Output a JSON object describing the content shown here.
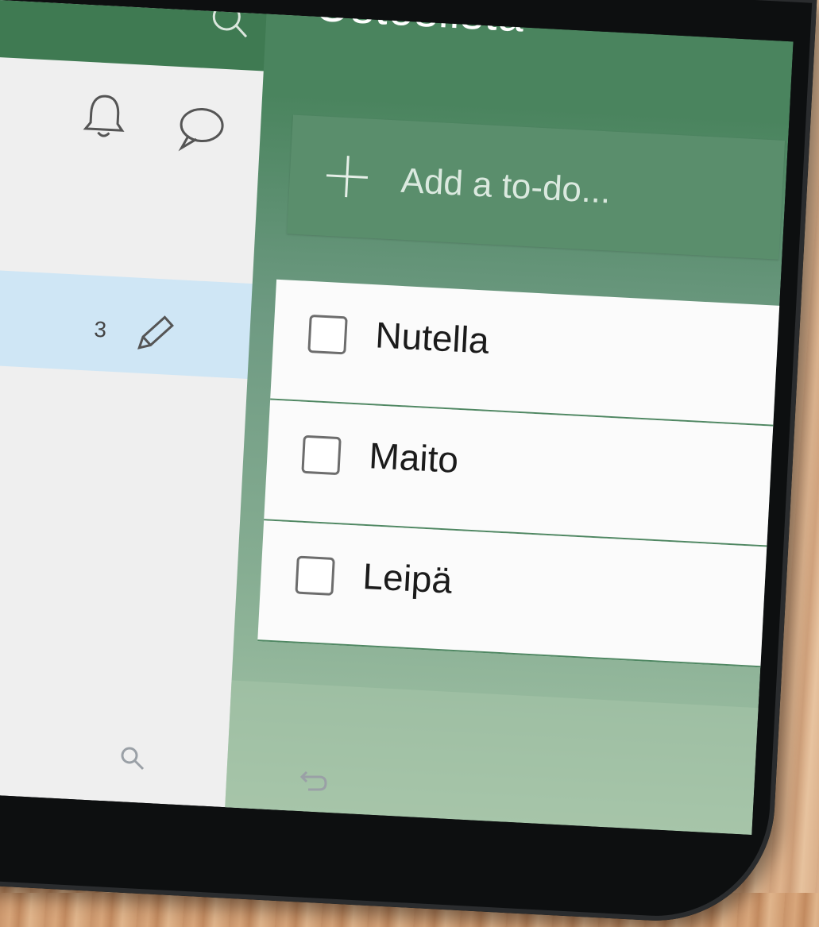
{
  "app": {
    "list_title": "Ostoslista",
    "add_placeholder": "Add a to-do...",
    "selected_list_count": "3"
  },
  "todos": [
    {
      "label": "Nutella",
      "checked": false
    },
    {
      "label": "Maito",
      "checked": false
    },
    {
      "label": "Leipä",
      "checked": false
    }
  ],
  "colors": {
    "accent_green": "#4a845e",
    "selected_row_blue": "#cfe6f5",
    "left_pane_bg": "#efefef"
  },
  "icons": {
    "top_search": "search-icon",
    "notifications": "bell-icon",
    "comments": "chat-icon",
    "edit": "pencil-icon",
    "add": "plus-icon",
    "nav_search": "search-icon",
    "nav_back": "back-icon"
  }
}
